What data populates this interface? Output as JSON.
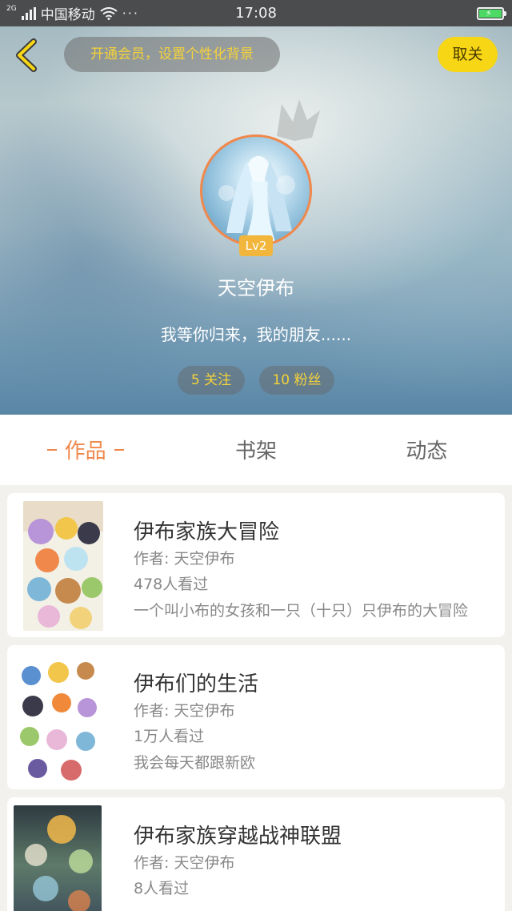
{
  "status_bar": {
    "network": "2G",
    "carrier": "中国移动",
    "dots": "···",
    "time": "17:08",
    "battery_level": 1.0
  },
  "header": {
    "vip_prompt": "开通会员，设置个性化背景",
    "follow_button": "取关"
  },
  "profile": {
    "level": "Lv2",
    "username": "天空伊布",
    "signature": "我等你归来，我的朋友......",
    "following": "5 关注",
    "fans": "10 粉丝"
  },
  "tabs": [
    {
      "label": "作品",
      "active": true
    },
    {
      "label": "书架",
      "active": false
    },
    {
      "label": "动态",
      "active": false
    }
  ],
  "works": [
    {
      "title": "伊布家族大冒险",
      "author": "作者: 天空伊布",
      "views": "478人看过",
      "description": "一个叫小布的女孩和一只（十只）只伊布的大冒险"
    },
    {
      "title": "伊布们的生活",
      "author": "作者: 天空伊布",
      "views": "1万人看过",
      "description": "我会每天都跟新欧"
    },
    {
      "title": "伊布家族穿越战神联盟",
      "author": "作者: 天空伊布",
      "views": "8人看过",
      "description": ""
    }
  ],
  "colors": {
    "accent": "#f0884c",
    "follow_button_bg": "#f6d615",
    "stat_text": "#f5d23a",
    "level_badge": "#f1b63b"
  }
}
